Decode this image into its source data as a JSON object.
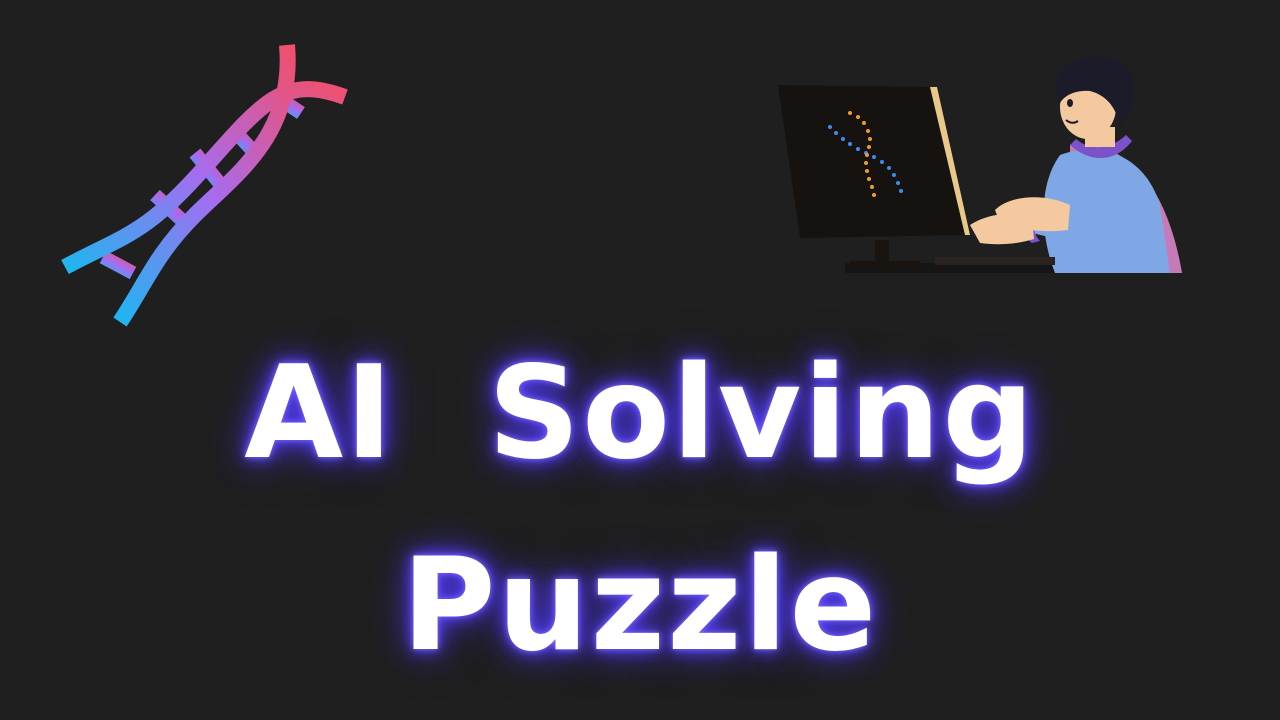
{
  "title": {
    "line1": "AI  Solving",
    "line2": "Puzzle"
  },
  "colors": {
    "background": "#1f1f1f",
    "text": "#ffffff",
    "glow": "#5b46ff",
    "dna_gradient_start": "#1fb6f0",
    "dna_gradient_mid": "#a66cf0",
    "dna_gradient_end": "#f0506e"
  },
  "icons": {
    "dna": "dna-helix-icon",
    "illustration": "person-at-computer-illustration"
  }
}
